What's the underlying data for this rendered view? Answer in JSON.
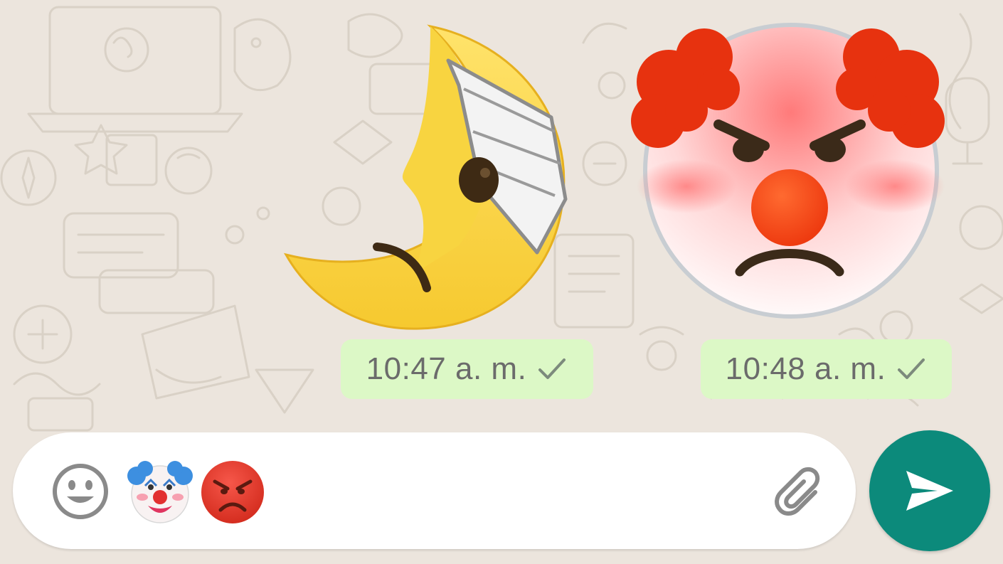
{
  "theme": {
    "chat_background": "#ece5dd",
    "doodle_color": "#d9d1c6",
    "outgoing_bubble": "#dcf8c6",
    "send_button": "#0c8a7b",
    "icon_gray": "#8a8a8a"
  },
  "messages": [
    {
      "type": "sticker",
      "sticker": "bandaged-crescent-moon-face",
      "time": "10:47 a. m.",
      "status": "sent-check-icon"
    },
    {
      "type": "sticker",
      "sticker": "angry-clown-face",
      "time": "10:48 a. m.",
      "status": "sent-check-icon"
    }
  ],
  "composer": {
    "emoji_button_icon": "smiley-icon",
    "draft_emojis": [
      "clown-face-emoji",
      "angry-face-emoji"
    ],
    "attach_icon": "paperclip-icon",
    "send_icon": "send-arrow-icon"
  }
}
